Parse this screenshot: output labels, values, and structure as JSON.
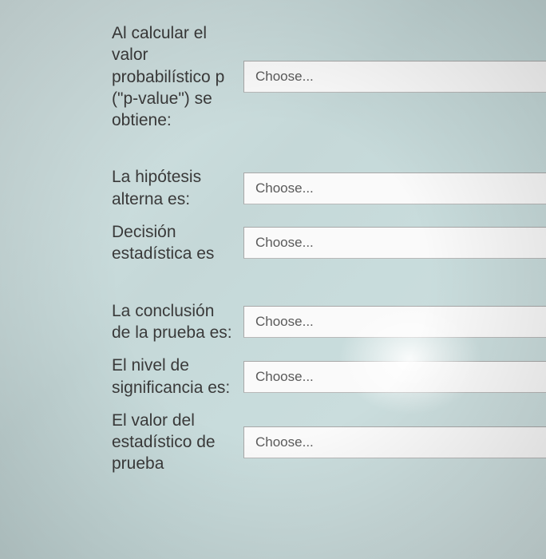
{
  "questions": [
    {
      "label": "Al calcular el valor probabilístico p (\"p-value\") se obtiene:",
      "placeholder": "Choose..."
    },
    {
      "label": "La hipótesis alterna es:",
      "placeholder": "Choose..."
    },
    {
      "label": "Decisión estadística es",
      "placeholder": "Choose..."
    },
    {
      "label": "La conclusión de la prueba es:",
      "placeholder": "Choose..."
    },
    {
      "label": "El nivel de significancia es:",
      "placeholder": "Choose..."
    },
    {
      "label": "El valor del estadístico de prueba",
      "placeholder": "Choose..."
    }
  ]
}
